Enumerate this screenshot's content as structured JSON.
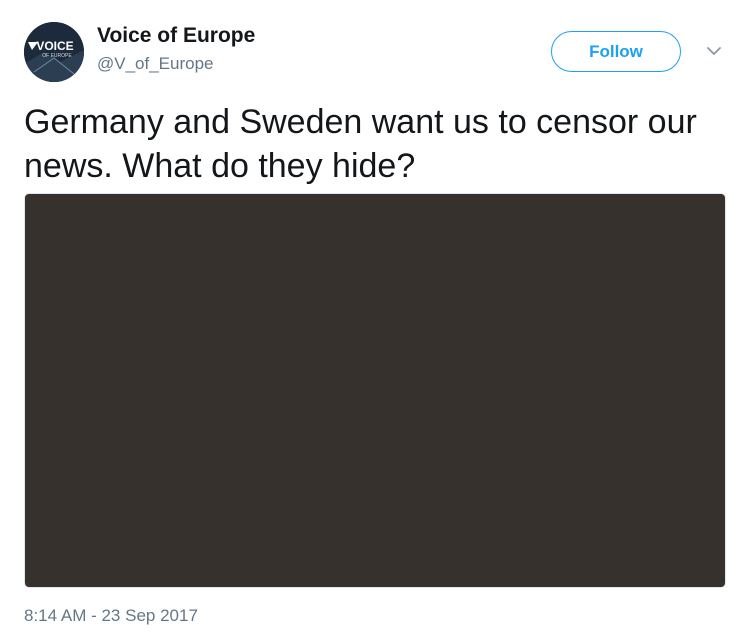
{
  "author": {
    "display_name": "Voice of Europe",
    "handle": "@V_of_Europe",
    "avatar_icon": "voice-of-europe-logo",
    "avatar_logo_text": "VOICE",
    "avatar_logo_subtext": "OF EUROPE"
  },
  "actions": {
    "follow_label": "Follow",
    "more_icon": "chevron-down-icon"
  },
  "tweet": {
    "text": "Germany and Sweden want us to censor our news. What do they hide?",
    "media_color": "#36312d",
    "timestamp": "8:14 AM - 23 Sep 2017"
  },
  "colors": {
    "accent": "#1da1f2",
    "text_primary": "#14171a",
    "text_secondary": "#657786"
  }
}
